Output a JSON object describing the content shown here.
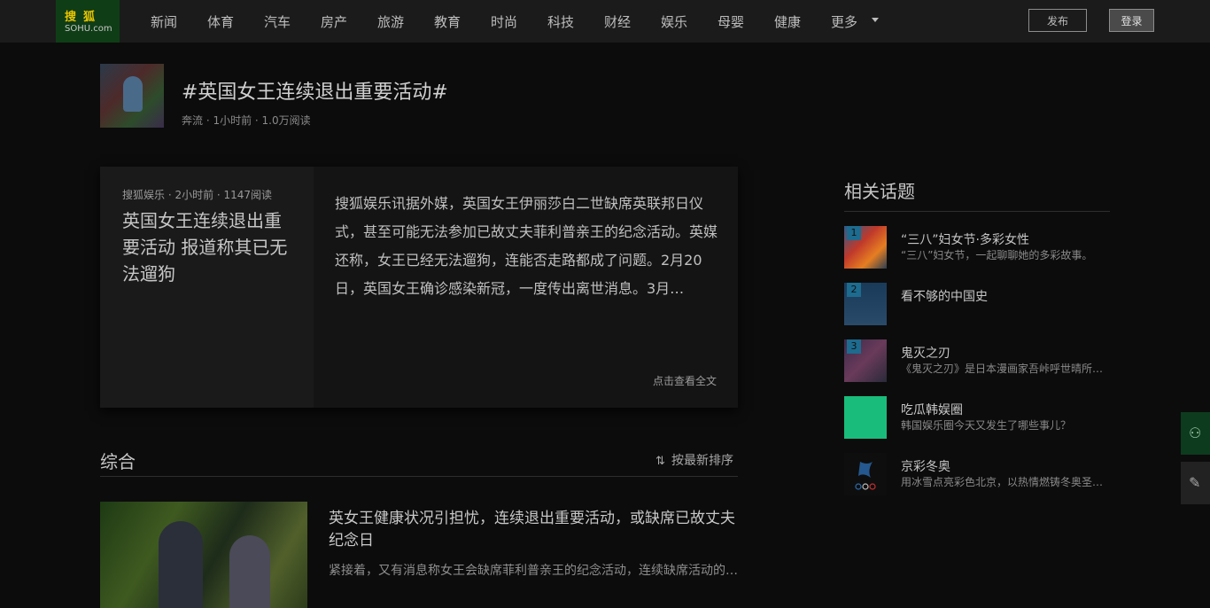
{
  "header": {
    "logo_top": "搜狐",
    "logo_bottom": "SOHU.com",
    "nav": [
      "新闻",
      "体育",
      "汽车",
      "房产",
      "旅游",
      "教育",
      "时尚",
      "科技",
      "财经",
      "娱乐",
      "母婴",
      "健康",
      "更多"
    ],
    "publish_button": "发布",
    "login_button": "登录"
  },
  "topic": {
    "title": "#英国女王连续退出重要活动#",
    "meta": "奔流 · 1小时前 · 1.0万阅读"
  },
  "featured": {
    "source": "搜狐娱乐 · 2小时前 · 1147阅读",
    "headline": "英国女王连续退出重要活动 报道称其已无法遛狗",
    "body": "搜狐娱乐讯据外媒，英国女王伊丽莎白二世缺席英联邦日仪式，甚至可能无法参加已故丈夫菲利普亲王的纪念活动。英媒还称，女王已经无法遛狗，连能否走路都成了问题。2月20日，英国女王确诊感染新冠，一度传出离世消息。3月…",
    "more": "点击查看全文"
  },
  "section": {
    "title": "综合",
    "sort_label": "按最新排序",
    "sort_icon": "sort-icon"
  },
  "articles": [
    {
      "title": "英女王健康状况引担忧，连续退出重要活动，或缺席已故丈夫纪念日",
      "desc": "紧接着，又有消息称女王会缺席菲利普亲王的纪念活动，连续缺席活动的…"
    }
  ],
  "sidebar": {
    "title": "相关话题",
    "topics": [
      {
        "rank": "1",
        "title": "“三八”妇女节·多彩女性",
        "desc": "“三八”妇女节，一起聊聊她的多彩故事。"
      },
      {
        "rank": "2",
        "title": "看不够的中国史",
        "desc": ""
      },
      {
        "rank": "3",
        "title": "鬼灭之刃",
        "desc": "《鬼灭之刃》是日本漫画家吾峠呼世晴所…"
      },
      {
        "rank": "",
        "title": "吃瓜韩娱圈",
        "desc": "韩国娱乐圈今天又发生了哪些事儿？"
      },
      {
        "rank": "",
        "title": "京彩冬奥",
        "desc": "用冰雪点亮彩色北京，以热情燃铸冬奥圣…"
      }
    ]
  },
  "float_buttons": {
    "home_icon": "sohu-icon",
    "edit_icon": "pencil-icon"
  }
}
